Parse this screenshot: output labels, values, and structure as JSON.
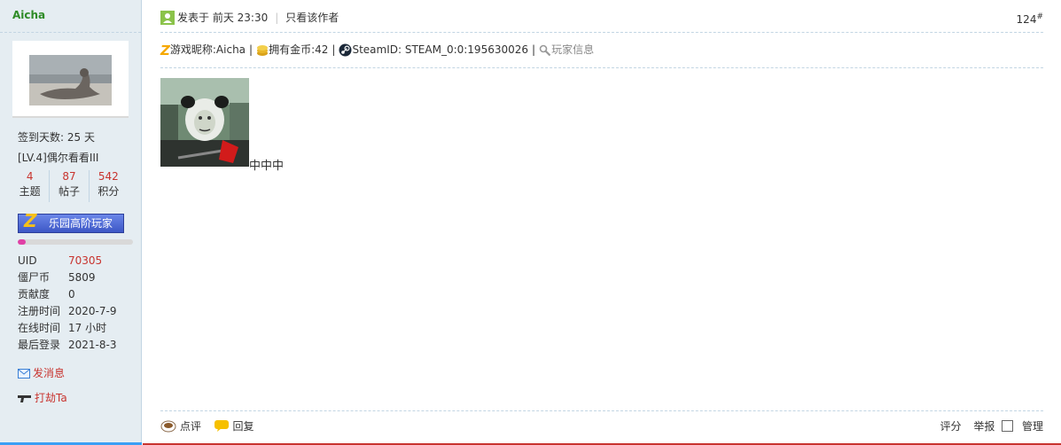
{
  "sidebar": {
    "username": "Aicha",
    "signin_days": "签到天数: 25 天",
    "level": "[LV.4]偶尔看看III",
    "stats": [
      {
        "value": "4",
        "label": "主题"
      },
      {
        "value": "87",
        "label": "帖子"
      },
      {
        "value": "542",
        "label": "积分"
      }
    ],
    "medal_label": "乐园高阶玩家",
    "level_progress": 0.07,
    "profile": [
      {
        "key": "UID",
        "value": "70305"
      },
      {
        "key": "僵尸币",
        "value": "5809"
      },
      {
        "key": "贡献度",
        "value": "0"
      },
      {
        "key": "注册时间",
        "value": "2020-7-9"
      },
      {
        "key": "在线时间",
        "value": "17 小时"
      },
      {
        "key": "最后登录",
        "value": "2021-8-3"
      }
    ],
    "send_message": "发消息",
    "rob": "打劫Ta"
  },
  "post": {
    "posted_label": "发表于 前天 23:30",
    "author_only": "只看该作者",
    "floor_number": "124",
    "floor_mark": "#",
    "game_nick": "游戏昵称:Aicha",
    "coins": "拥有金币:42",
    "steam_id": "SteamID: STEAM_0:0:195630026",
    "player_info": "玩家信息",
    "content": "中中中"
  },
  "footer": {
    "comment": "点评",
    "reply": "回复",
    "rate": "评分",
    "report": "举报",
    "manage": "管理"
  },
  "colors": {
    "sidebar_bg": "#e5edf2",
    "username": "#2e8b26",
    "accent_red": "#c8342f",
    "divider": "#c2d5e3"
  }
}
